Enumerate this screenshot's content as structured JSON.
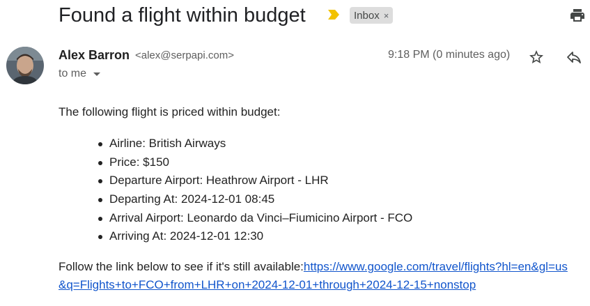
{
  "email": {
    "subject": "Found a flight within budget",
    "label": "Inbox",
    "label_remove": "×",
    "sender": {
      "name": "Alex Barron",
      "email": "<alex@serpapi.com>"
    },
    "timestamp": "9:18 PM (0 minutes ago)",
    "recipient": "to me",
    "body": {
      "intro": "The following flight is priced within budget:",
      "details": [
        "Airline: British Airways",
        "Price: $150",
        "Departure Airport: Heathrow Airport - LHR",
        "Departing At: 2024-12-01 08:45",
        "Arrival Airport: Leonardo da Vinci–Fiumicino Airport - FCO",
        "Arriving At: 2024-12-01 12:30"
      ],
      "follow_text": "Follow the link below to see if it's still available:",
      "link": "https://www.google.com/travel/flights?hl=en&gl=us&q=Flights+to+FCO+from+LHR+on+2024-12-01+through+2024-12-15+nonstop"
    }
  },
  "icons": {
    "importance": "importance-marker-icon",
    "print": "print-icon",
    "star": "star-icon",
    "reply": "reply-icon",
    "caret": "chevron-down-icon"
  },
  "colors": {
    "importance": "#f2c200",
    "chip_bg": "#dddddd",
    "link": "#1155cc",
    "muted": "#5e5e5e"
  }
}
